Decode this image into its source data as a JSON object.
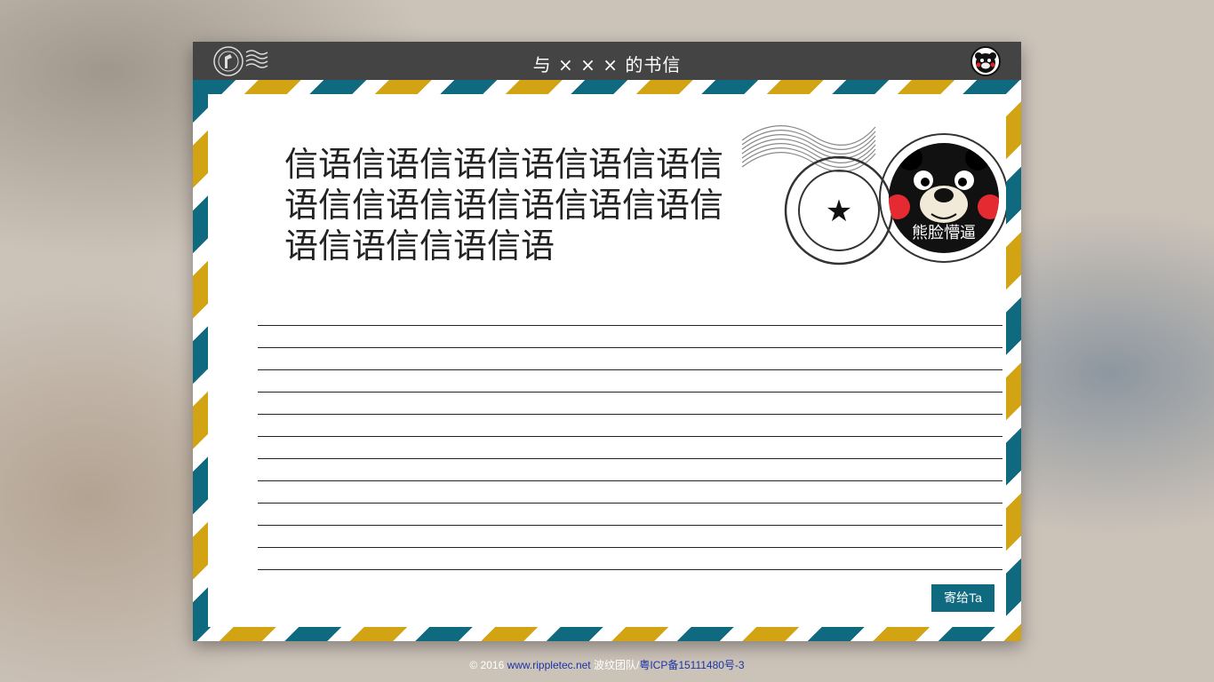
{
  "header": {
    "title": "与 × × × 的书信",
    "logo_icon": "postmark-logo-icon",
    "avatar_icon": "kumamon-avatar-icon"
  },
  "letter": {
    "message": "信语信语信语信语信语信语信语信信语信语信语信语信语信语信语信信语信语",
    "stamp": {
      "caption": "熊脸懵逼",
      "icon": "star-icon"
    },
    "send_button": "寄给Ta"
  },
  "footer": {
    "copyright": "© 2016 ",
    "site_link": "www.rippletec.net",
    "team": " 波纹团队/",
    "icp_link": "粤ICP备15111480号-3"
  },
  "colors": {
    "teal": "#0f6a80",
    "gold": "#d2a414",
    "bar": "#444444"
  }
}
